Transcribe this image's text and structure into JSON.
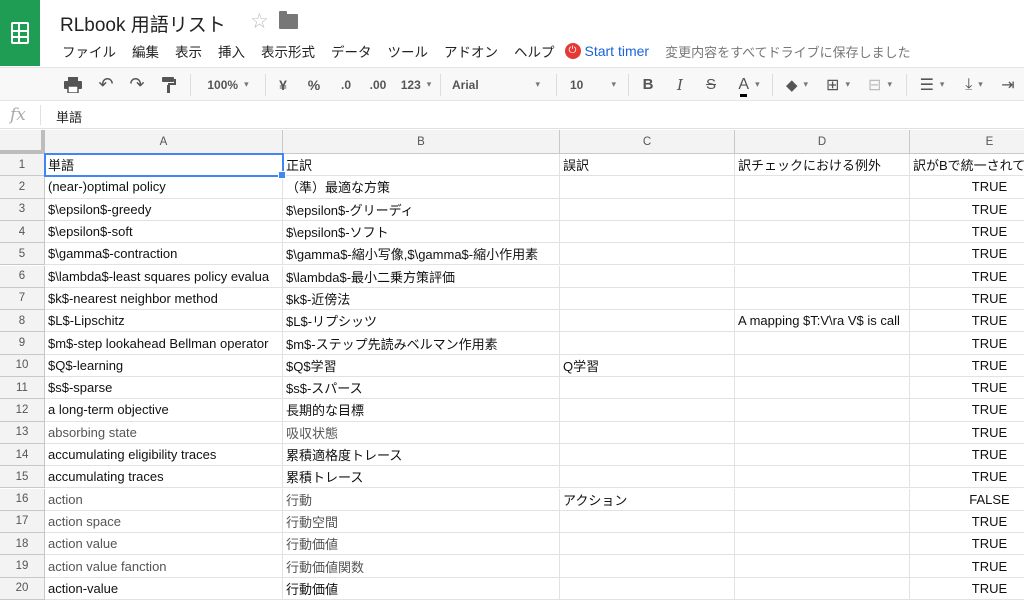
{
  "app": {
    "title": "RLbook 用語リスト",
    "star_icon": "star-outline-icon",
    "folder_icon": "folder-icon"
  },
  "menu": [
    "ファイル",
    "編集",
    "表示",
    "挿入",
    "表示形式",
    "データ",
    "ツール",
    "アドオン",
    "ヘルプ"
  ],
  "timer": {
    "label": "Start timer",
    "icon": "power-icon",
    "color": "#e53935"
  },
  "save_status": "変更内容をすべてドライブに保存しました",
  "toolbar": {
    "zoom": "100%",
    "currency": "¥",
    "percent": "%",
    "dec_decrease": ".0",
    "dec_increase": ".00",
    "more_formats": "123",
    "font": "Arial",
    "font_size": "10",
    "bold": "B",
    "italic": "I",
    "strike": "S",
    "text_color": "A"
  },
  "formula_bar": {
    "fx": "fx",
    "content": "単語"
  },
  "columns": [
    "A",
    "B",
    "C",
    "D",
    "E"
  ],
  "rows": [
    {
      "n": "1",
      "a": "単語",
      "b": "正訳",
      "c": "誤訳",
      "d": "訳チェックにおける例外",
      "e": "訳がBで統一されて"
    },
    {
      "n": "2",
      "a": "(near-)optimal policy",
      "b": "（準）最適な方策",
      "c": "",
      "d": "",
      "e": "TRUE"
    },
    {
      "n": "3",
      "a": "$\\epsilon$-greedy",
      "b": "$\\epsilon$-グリーディ",
      "c": "",
      "d": "",
      "e": "TRUE"
    },
    {
      "n": "4",
      "a": "$\\epsilon$-soft",
      "b": "$\\epsilon$-ソフト",
      "c": "",
      "d": "",
      "e": "TRUE"
    },
    {
      "n": "5",
      "a": "$\\gamma$-contraction",
      "b": "$\\gamma$-縮小写像,$\\gamma$-縮小作用素",
      "c": "",
      "d": "",
      "e": "TRUE"
    },
    {
      "n": "6",
      "a": "$\\lambda$-least squares policy evalua",
      "b": "$\\lambda$-最小二乗方策評価",
      "c": "",
      "d": "",
      "e": "TRUE"
    },
    {
      "n": "7",
      "a": "$k$-nearest neighbor method",
      "b": "$k$-近傍法",
      "c": "",
      "d": "",
      "e": "TRUE"
    },
    {
      "n": "8",
      "a": "$L$-Lipschitz",
      "b": "$L$-リプシッツ",
      "c": "",
      "d": "A mapping $T:V\\ra V$ is call",
      "e": "TRUE"
    },
    {
      "n": "9",
      "a": "$m$-step lookahead Bellman operator",
      "b": "$m$-ステップ先読みベルマン作用素",
      "c": "",
      "d": "",
      "e": "TRUE"
    },
    {
      "n": "10",
      "a": "$Q$-learning",
      "b": "$Q$学習",
      "c": "Q学習",
      "d": "",
      "e": "TRUE"
    },
    {
      "n": "11",
      "a": "$s$-sparse",
      "b": "$s$-スパース",
      "c": "",
      "d": "",
      "e": "TRUE"
    },
    {
      "n": "12",
      "a": "a long-term objective",
      "b": "長期的な目標",
      "c": "",
      "d": "",
      "e": "TRUE"
    },
    {
      "n": "13",
      "a": "absorbing state",
      "b": "吸収状態",
      "c": "",
      "d": "",
      "e": "TRUE"
    },
    {
      "n": "14",
      "a": "accumulating eligibility traces",
      "b": "累積適格度トレース",
      "c": "",
      "d": "",
      "e": "TRUE"
    },
    {
      "n": "15",
      "a": "accumulating traces",
      "b": "累積トレース",
      "c": "",
      "d": "",
      "e": "TRUE"
    },
    {
      "n": "16",
      "a": "action",
      "b": "行動",
      "c": "アクション",
      "d": "",
      "e": "FALSE"
    },
    {
      "n": "17",
      "a": "action space",
      "b": "行動空間",
      "c": "",
      "d": "",
      "e": "TRUE"
    },
    {
      "n": "18",
      "a": "action value",
      "b": "行動価値",
      "c": "",
      "d": "",
      "e": "TRUE"
    },
    {
      "n": "19",
      "a": "action value fanction",
      "b": "行動価値関数",
      "c": "",
      "d": "",
      "e": "TRUE"
    },
    {
      "n": "20",
      "a": "action-value",
      "b": "行動価値",
      "c": "",
      "d": "",
      "e": "TRUE"
    }
  ],
  "gray_rows": [
    "13",
    "16",
    "17",
    "18",
    "19"
  ]
}
